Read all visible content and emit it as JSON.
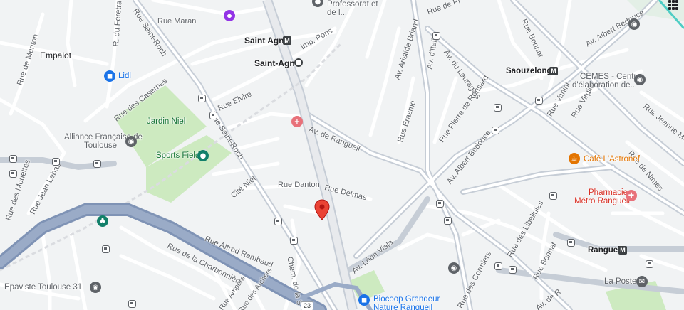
{
  "streets": {
    "rue_maran": "Rue Maran",
    "rue_du_feretra": "R. du Feretra",
    "rue_saint_roch_top": "Rue Saint-Roch",
    "rue_saint_roch_mid": "Rue Saint-Roch",
    "rue_des_casernes": "Rue des Casernes",
    "rue_elvire": "Rue Elvire",
    "imp_pons": "Imp. Pons",
    "av_de_rangueil": "Av. de Rangueil",
    "av_aristide_briand": "Av. Aristide Briand",
    "av_ditalie": "Av. d'Italie",
    "rue_de_pl": "Rue de Pl",
    "av_du_lauragais": "Av. du Lauragais",
    "rue_bonnat_top": "Rue Bonnat",
    "av_albert_bedouce_top": "Av. Albert Bedouce",
    "rue_erasme": "Rue Erasme",
    "rue_pierre_de_ronsard": "Rue Pierre de Ronsard",
    "av_albert_bedouce_mid": "Av. Albert Bedouce",
    "rue_vanini": "Rue Vanini",
    "rue_virgile": "Rue Virgile",
    "rue_jeanne_marvig": "Rue Jeanne Marvig",
    "rue_de_nimes": "Rue de Nimes",
    "rue_de_menton": "Rue de Menton",
    "rue_des_mouettes": "Rue des Mouettes",
    "rue_jean_lebas": "Rue Jean Lebas",
    "cite_niel": "Cité Niel",
    "rue_danton": "Rue Danton",
    "rue_delmas": "Rue Delmas",
    "rue_alfred_rambaud": "Rue Alfred Rambaud",
    "rue_de_la_charbonniere": "Rue de la Charbonnière",
    "chem_de_la_s": "Chem. de la S",
    "av_leon_viala": "Av. Léon Viala",
    "rue_des_libellules": "Rue des Libellules",
    "rue_des_cormiers": "Rue des Cormiers",
    "rue_bonnat_bottom": "Rue Bonnat",
    "av_de_r": "Av. de R",
    "rue_ampere": "Rue Ampère",
    "rue_des_archers": "Rue des Archers",
    "route_shield": "23"
  },
  "places": {
    "empalot": "Empalot",
    "lidl": "Lidl",
    "saint_agne_metro": "Saint Agne",
    "saint_agne_station": "Saint-Agne",
    "professorat_line1": "Professorat et",
    "professorat_line2": "de l...",
    "jardin_niel": "Jardin Niel",
    "alliance_line1": "Alliance Française de",
    "alliance_line2": "Toulouse",
    "sports_field": "Sports Field",
    "saouzelong": "Saouzelong",
    "cemes_line1": "CEMES - Centre",
    "cemes_line2": "d'élaboration de...",
    "cafe": "Café L'Astronef",
    "pharmacie_line1": "Pharmacie",
    "pharmacie_line2": "Métro Rangueil",
    "rangueil": "Rangueil",
    "la_poste": "La Poste",
    "epaviste": "Epaviste Toulouse 31",
    "biocoop_line1": "Biocoop Grandeur",
    "biocoop_line2": "Nature Rangueil",
    "metro_glyph": "M"
  },
  "colors": {
    "background": "#f1f3f4",
    "road": "#ffffff",
    "major_road": "#c6cdd6",
    "highway": "#8fa3c3",
    "park": "#cdeac0",
    "pin": "#ea4335",
    "cafe": "#e37400",
    "pharmacy": "#d93025",
    "shop": "#1a73e8",
    "place_teal": "#12806a"
  }
}
